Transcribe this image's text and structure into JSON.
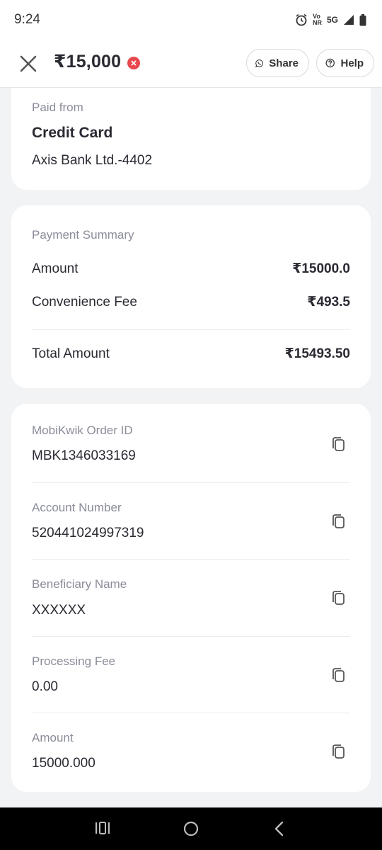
{
  "status_bar": {
    "time": "9:24",
    "network_top": "Vo",
    "network_bottom": "NR",
    "network_type": "5G"
  },
  "header": {
    "amount": "₹15,000",
    "share_label": "Share",
    "help_label": "Help"
  },
  "paid_from": {
    "label": "Paid from",
    "method": "Credit Card",
    "account": "Axis Bank Ltd.-4402"
  },
  "payment_summary": {
    "title": "Payment Summary",
    "rows": [
      {
        "label": "Amount",
        "value": "₹15000.0"
      },
      {
        "label": "Convenience Fee",
        "value": "₹493.5"
      }
    ],
    "total_label": "Total Amount",
    "total_value": "₹15493.50"
  },
  "details": [
    {
      "label": "MobiKwik Order ID",
      "value": "MBK1346033169"
    },
    {
      "label": "Account Number",
      "value": "520441024997319"
    },
    {
      "label": "Beneficiary Name",
      "value": "XXXXXX"
    },
    {
      "label": "Processing Fee",
      "value": "0.00"
    },
    {
      "label": "Amount",
      "value": "15000.000"
    }
  ],
  "colors": {
    "accent_red": "#e8484e",
    "background": "#f2f3f5",
    "card": "#ffffff",
    "muted_text": "#8a8c99"
  }
}
